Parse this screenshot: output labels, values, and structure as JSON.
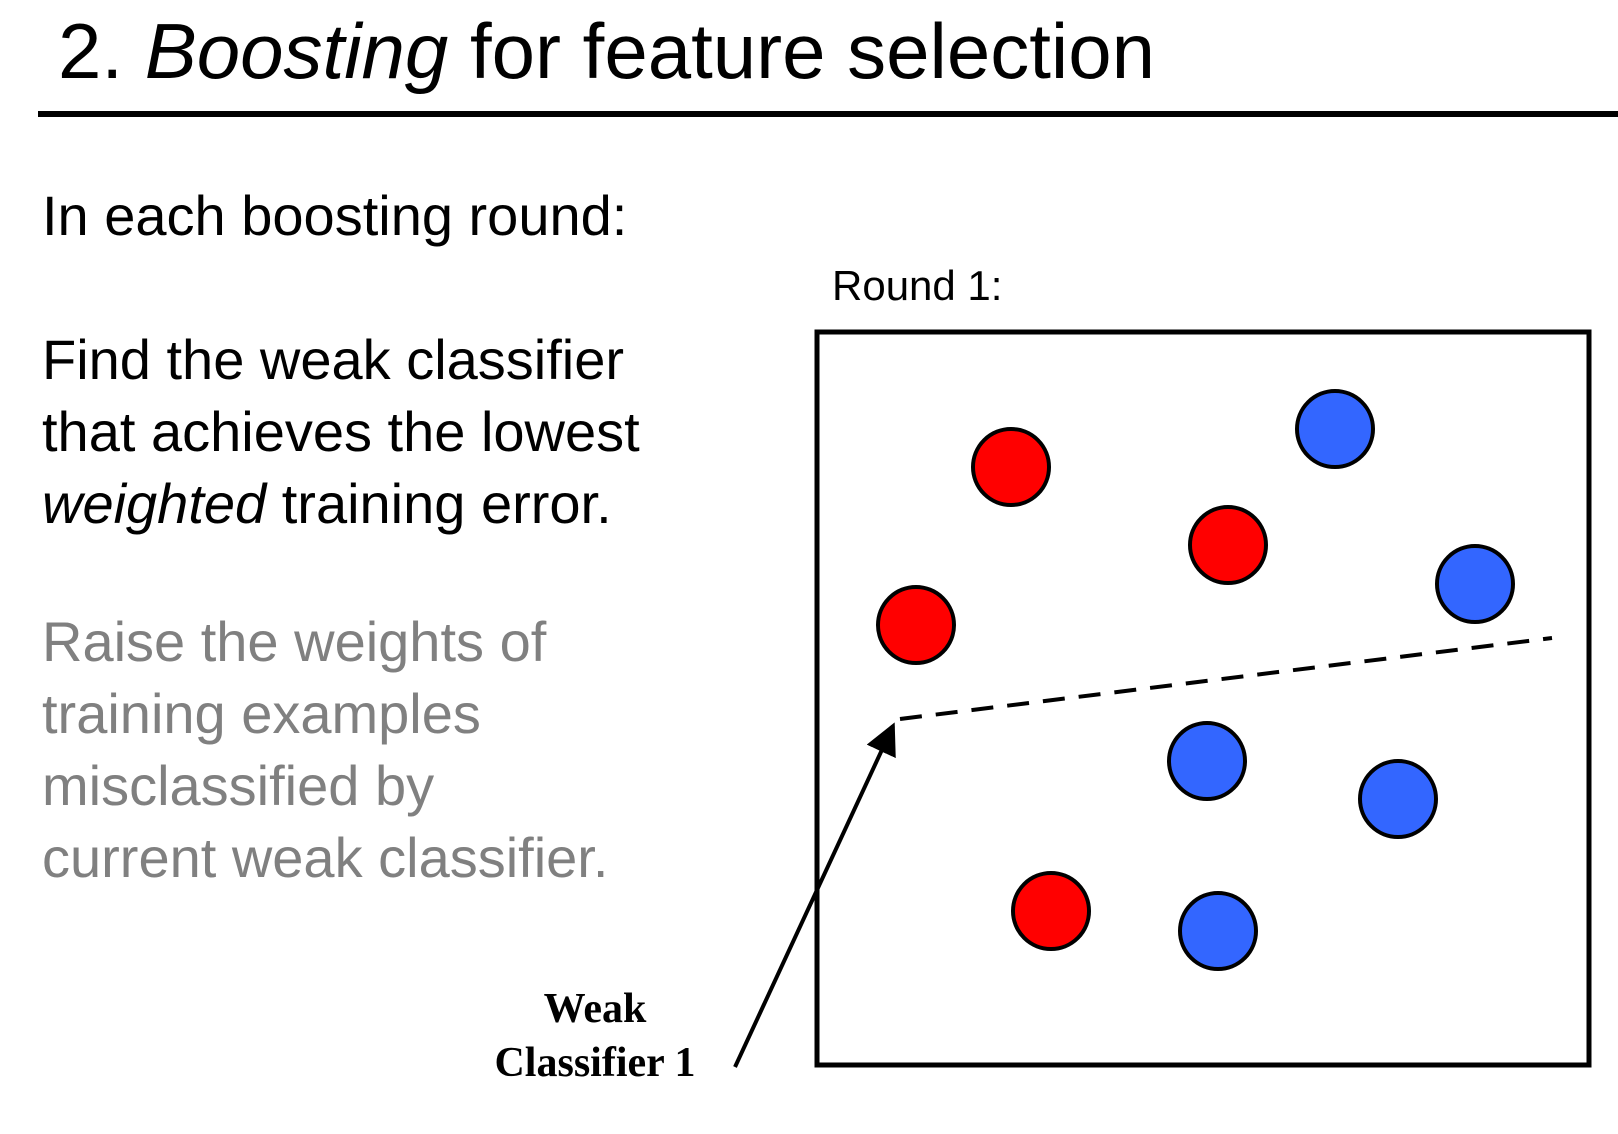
{
  "slide": {
    "title_number": "2.",
    "title_emphasis": "Boosting",
    "title_rest": "for feature selection",
    "intro": "In each boosting round:",
    "step1_lines": [
      "Find the weak classifier",
      "that achieves the lowest"
    ],
    "step1_emphasis": "weighted",
    "step1_tail": "training error.",
    "step2_lines": [
      "Raise the weights of",
      "training examples",
      "misclassified by",
      "current weak classifier."
    ],
    "step2_color": "#808080",
    "round_label": "Round 1:",
    "weak_label_lines": [
      "Weak",
      "Classifier 1"
    ]
  },
  "colors": {
    "positive": "#ff0000",
    "negative": "#3366ff",
    "outline": "#000000"
  },
  "points": [
    {
      "class": "red"
    },
    {
      "class": "blue"
    },
    {
      "class": "red"
    },
    {
      "class": "blue"
    },
    {
      "class": "red"
    },
    {
      "class": "blue"
    },
    {
      "class": "blue"
    },
    {
      "class": "red"
    },
    {
      "class": "blue"
    }
  ]
}
